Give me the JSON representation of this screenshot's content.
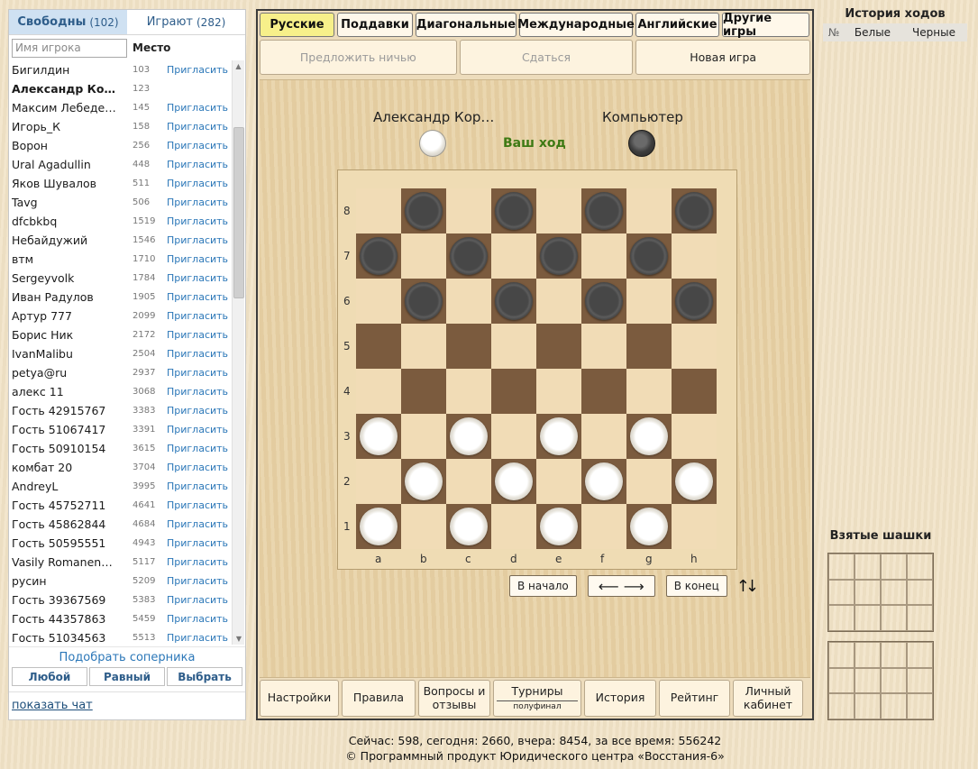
{
  "sidebar": {
    "tab_free_label": "Свободны",
    "tab_free_count": "(102)",
    "tab_playing_label": "Играют",
    "tab_playing_count": "(282)",
    "search_placeholder": "Имя игрока",
    "place_header": "Место",
    "invite_label": "Пригласить",
    "players": [
      {
        "name": "Бигилдин",
        "rank": "103",
        "invite": true,
        "bold": false
      },
      {
        "name": "Александр Ко…",
        "rank": "123",
        "invite": false,
        "bold": true
      },
      {
        "name": "Максим Лебеде…",
        "rank": "145",
        "invite": true,
        "bold": false
      },
      {
        "name": "Игорь_К",
        "rank": "158",
        "invite": true,
        "bold": false
      },
      {
        "name": "Ворон",
        "rank": "256",
        "invite": true,
        "bold": false
      },
      {
        "name": "Ural Agadullin",
        "rank": "448",
        "invite": true,
        "bold": false
      },
      {
        "name": "Яков Шувалов",
        "rank": "511",
        "invite": true,
        "bold": false
      },
      {
        "name": "Tavg",
        "rank": "506",
        "invite": true,
        "bold": false
      },
      {
        "name": "dfcbkbq",
        "rank": "1519",
        "invite": true,
        "bold": false
      },
      {
        "name": "Небайдужий",
        "rank": "1546",
        "invite": true,
        "bold": false
      },
      {
        "name": "втм",
        "rank": "1710",
        "invite": true,
        "bold": false
      },
      {
        "name": "Sergeyvolk",
        "rank": "1784",
        "invite": true,
        "bold": false
      },
      {
        "name": "Иван Радулов",
        "rank": "1905",
        "invite": true,
        "bold": false
      },
      {
        "name": "Артур 777",
        "rank": "2099",
        "invite": true,
        "bold": false
      },
      {
        "name": "Борис Ник",
        "rank": "2172",
        "invite": true,
        "bold": false
      },
      {
        "name": "IvanMalibu",
        "rank": "2504",
        "invite": true,
        "bold": false
      },
      {
        "name": "petya@ru",
        "rank": "2937",
        "invite": true,
        "bold": false
      },
      {
        "name": "алекс 11",
        "rank": "3068",
        "invite": true,
        "bold": false
      },
      {
        "name": "Гость 42915767",
        "rank": "3383",
        "invite": true,
        "bold": false
      },
      {
        "name": "Гость 51067417",
        "rank": "3391",
        "invite": true,
        "bold": false
      },
      {
        "name": "Гость 50910154",
        "rank": "3615",
        "invite": true,
        "bold": false
      },
      {
        "name": "комбат 20",
        "rank": "3704",
        "invite": true,
        "bold": false
      },
      {
        "name": "AndreyL",
        "rank": "3995",
        "invite": true,
        "bold": false
      },
      {
        "name": "Гость 45752711",
        "rank": "4641",
        "invite": true,
        "bold": false
      },
      {
        "name": "Гость 45862844",
        "rank": "4684",
        "invite": true,
        "bold": false
      },
      {
        "name": "Гость 50595551",
        "rank": "4943",
        "invite": true,
        "bold": false
      },
      {
        "name": "Vasily Romanen…",
        "rank": "5117",
        "invite": true,
        "bold": false
      },
      {
        "name": "русин",
        "rank": "5209",
        "invite": true,
        "bold": false
      },
      {
        "name": "Гость 39367569",
        "rank": "5383",
        "invite": true,
        "bold": false
      },
      {
        "name": "Гость 44357863",
        "rank": "5459",
        "invite": true,
        "bold": false
      },
      {
        "name": "Гость 51034563",
        "rank": "5513",
        "invite": true,
        "bold": false
      }
    ],
    "find_opponent": "Подобрать соперника",
    "filters": [
      "Любой",
      "Равный",
      "Выбрать"
    ],
    "show_chat": "показать чат"
  },
  "game": {
    "tabs": [
      {
        "label": "Русские",
        "active": true
      },
      {
        "label": "Поддавки",
        "active": false
      },
      {
        "label": "Диагональные",
        "active": false
      },
      {
        "label": "Международные",
        "active": false
      },
      {
        "label": "Английские",
        "active": false
      },
      {
        "label": "Другие игры",
        "active": false
      }
    ],
    "actions": {
      "offer_draw": "Предложить ничью",
      "resign": "Сдаться",
      "new_game": "Новая игра"
    },
    "player_white": "Александр Кор…",
    "player_black": "Компьютер",
    "turn_text": "Ваш ход",
    "files": [
      "a",
      "b",
      "c",
      "d",
      "e",
      "f",
      "g",
      "h"
    ],
    "ranks": [
      "8",
      "7",
      "6",
      "5",
      "4",
      "3",
      "2",
      "1"
    ],
    "black_pieces": [
      "b8",
      "d8",
      "f8",
      "h8",
      "a7",
      "c7",
      "e7",
      "g7",
      "b6",
      "d6",
      "f6",
      "h6"
    ],
    "white_pieces": [
      "a3",
      "c3",
      "e3",
      "g3",
      "b2",
      "d2",
      "f2",
      "h2",
      "a1",
      "c1",
      "e1",
      "g1"
    ],
    "nav": {
      "to_start": "В начало",
      "arrows": "⟵ ⟶",
      "to_end": "В конец",
      "flip": "↑↓"
    },
    "bottom": [
      {
        "label": "Настройки",
        "sub": ""
      },
      {
        "label": "Правила",
        "sub": ""
      },
      {
        "label": "Вопросы и отзывы",
        "sub": ""
      },
      {
        "label": "Турниры",
        "sub": "полуфинал"
      },
      {
        "label": "История",
        "sub": ""
      },
      {
        "label": "Рейтинг",
        "sub": ""
      },
      {
        "label": "Личный кабинет",
        "sub": ""
      }
    ]
  },
  "history": {
    "title": "История ходов",
    "col_num": "№",
    "col_white": "Белые",
    "col_black": "Черные"
  },
  "captured": {
    "title": "Взятые шашки"
  },
  "footer": {
    "stats": "Сейчас: 598, сегодня: 2660, вчера: 8454, за все время: 556242",
    "copyright": "© Программный продукт Юридического центра «Восстания-6»"
  }
}
